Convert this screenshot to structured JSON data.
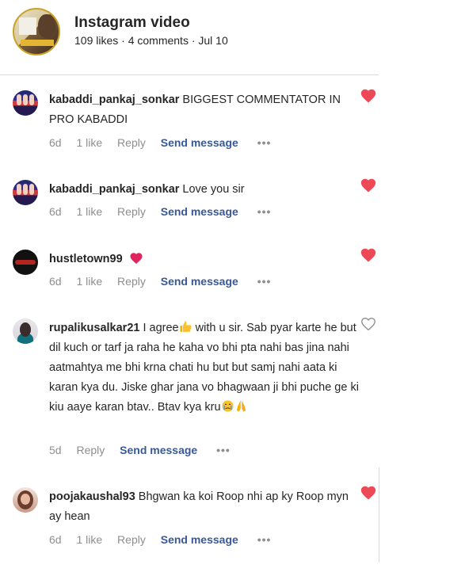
{
  "post": {
    "title": "Instagram video",
    "meta": "109 likes · 4 comments · Jul 10"
  },
  "comments": [
    {
      "user": "kabaddi_pankaj_sonkar",
      "text": "BIGGEST COMMENTATOR IN PRO KABADDI",
      "time": "6d",
      "likes": "1 like",
      "reply": "Reply",
      "send": "Send message",
      "liked": true
    },
    {
      "user": "kabaddi_pankaj_sonkar",
      "text": "Love you sir",
      "time": "6d",
      "likes": "1 like",
      "reply": "Reply",
      "send": "Send message",
      "liked": true
    },
    {
      "user": "hustletown99",
      "text": "",
      "time": "6d",
      "likes": "1 like",
      "reply": "Reply",
      "send": "Send message",
      "liked": true
    },
    {
      "user": "rupalikusalkar21",
      "text_a": "I agree",
      "text_b": " with u sir. Sab pyar karte he but dil kuch or tarf ja raha he kaha vo bhi pta nahi bas jina nahi aatmahtya me bhi krna chati hu but but samj nahi aata ki karan kya du. Jiske ghar jana vo bhagwaan ji bhi puche ge ki kiu aaye karan btav.. Btav kya kru",
      "time": "5d",
      "reply": "Reply",
      "send": "Send message",
      "liked": false
    },
    {
      "user": "poojakaushal93",
      "text": "Bhgwan ka koi Roop nhi ap ky Roop myn ay hean",
      "time": "6d",
      "likes": "1 like",
      "reply": "Reply",
      "send": "Send message",
      "liked": true
    }
  ],
  "icons": {
    "heart_filled": "heart-icon",
    "heart_outline": "heart-outline-icon",
    "more": "more-icon"
  },
  "colors": {
    "heart": "#ed4956",
    "link": "#385898",
    "muted": "#8e8e8e"
  }
}
